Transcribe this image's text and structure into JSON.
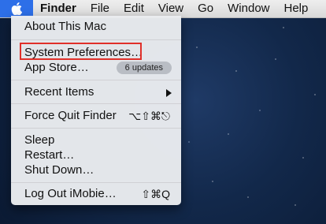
{
  "menubar": {
    "apple_icon": "apple-icon",
    "items": [
      "Finder",
      "File",
      "Edit",
      "View",
      "Go",
      "Window",
      "Help"
    ]
  },
  "apple_menu": {
    "about": "About This Mac",
    "system_preferences": "System Preferences…",
    "app_store": "App Store…",
    "app_store_badge": "6 updates",
    "recent_items": "Recent Items",
    "force_quit": "Force Quit Finder",
    "force_quit_shortcut": "⌥⇧⌘⎋",
    "sleep": "Sleep",
    "restart": "Restart…",
    "shut_down": "Shut Down…",
    "log_out": "Log Out iMobie…",
    "log_out_shortcut": "⇧⌘Q"
  },
  "colors": {
    "highlight_box": "#e0302a",
    "apple_selected": "#2d6fe8"
  }
}
